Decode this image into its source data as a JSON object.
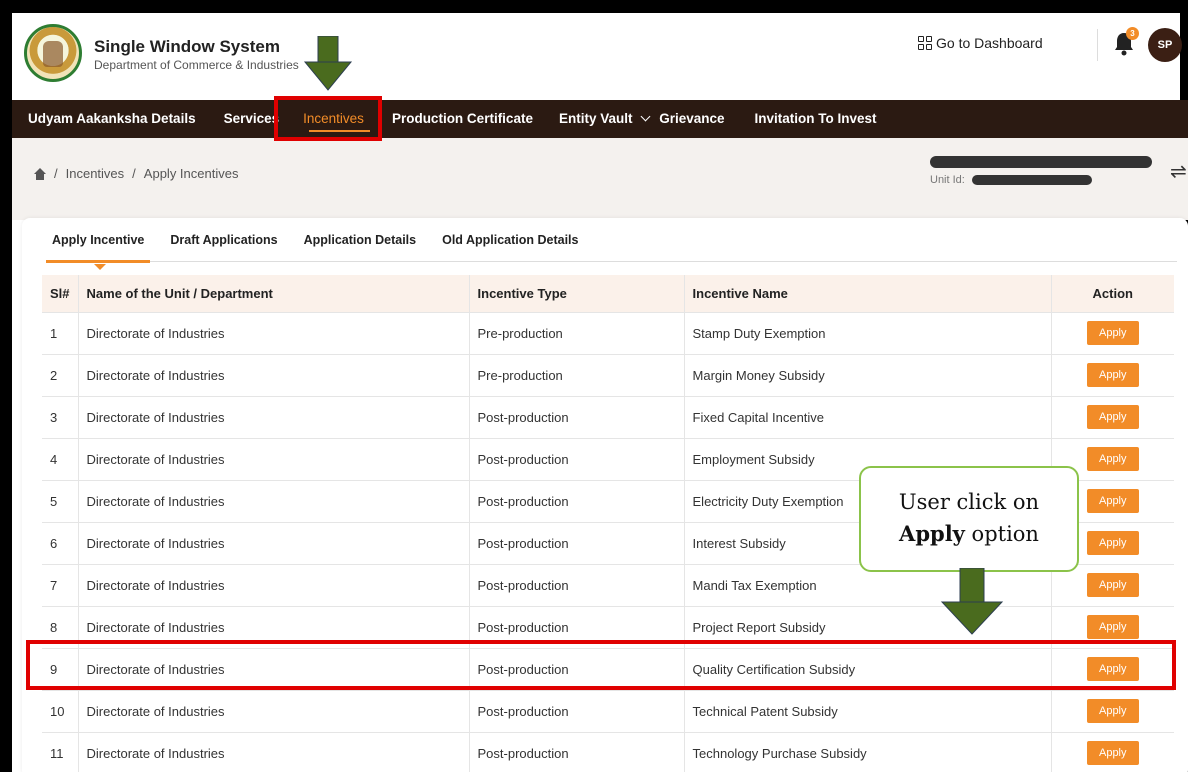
{
  "header": {
    "brand_title": "Single Window System",
    "brand_subtitle": "Department of Commerce & Industries",
    "dashboard_link": "Go to Dashboard",
    "notification_count": "3",
    "avatar_initials": "SP"
  },
  "nav": {
    "items": [
      {
        "label": "Udyam Aakanksha Details"
      },
      {
        "label": "Services"
      },
      {
        "label": "Incentives"
      },
      {
        "label": "Production Certificate"
      },
      {
        "label": "Entity Vault"
      },
      {
        "label": "Grievance"
      },
      {
        "label": "Invitation To Invest"
      }
    ]
  },
  "breadcrumb": {
    "items": [
      "Incentives",
      "Apply Incentives"
    ],
    "separator": "/"
  },
  "unit": {
    "id_label": "Unit Id:"
  },
  "tabs": [
    {
      "label": "Apply Incentive"
    },
    {
      "label": "Draft Applications"
    },
    {
      "label": "Application Details"
    },
    {
      "label": "Old Application Details"
    }
  ],
  "table": {
    "headers": [
      "Sl#",
      "Name of the Unit / Department",
      "Incentive Type",
      "Incentive Name",
      "Action"
    ],
    "action_label": "Apply",
    "rows": [
      {
        "sl": "1",
        "unit": "Directorate of Industries",
        "type": "Pre-production",
        "name": "Stamp Duty Exemption"
      },
      {
        "sl": "2",
        "unit": "Directorate of Industries",
        "type": "Pre-production",
        "name": "Margin Money Subsidy"
      },
      {
        "sl": "3",
        "unit": "Directorate of Industries",
        "type": "Post-production",
        "name": "Fixed Capital Incentive"
      },
      {
        "sl": "4",
        "unit": "Directorate of Industries",
        "type": "Post-production",
        "name": "Employment Subsidy"
      },
      {
        "sl": "5",
        "unit": "Directorate of Industries",
        "type": "Post-production",
        "name": "Electricity Duty Exemption"
      },
      {
        "sl": "6",
        "unit": "Directorate of Industries",
        "type": "Post-production",
        "name": "Interest Subsidy"
      },
      {
        "sl": "7",
        "unit": "Directorate of Industries",
        "type": "Post-production",
        "name": "Mandi Tax Exemption"
      },
      {
        "sl": "8",
        "unit": "Directorate of Industries",
        "type": "Post-production",
        "name": "Project Report Subsidy"
      },
      {
        "sl": "9",
        "unit": "Directorate of Industries",
        "type": "Post-production",
        "name": "Quality Certification Subsidy"
      },
      {
        "sl": "10",
        "unit": "Directorate of Industries",
        "type": "Post-production",
        "name": "Technical Patent Subsidy"
      },
      {
        "sl": "11",
        "unit": "Directorate of Industries",
        "type": "Post-production",
        "name": "Technology Purchase Subsidy"
      }
    ]
  },
  "annotation": {
    "callout_line1": "User click on",
    "callout_bold": "Apply",
    "callout_rest": " option"
  },
  "colors": {
    "accent": "#f28c28",
    "nav_bg": "#2b1a12",
    "highlight": "#e00000",
    "arrow": "#4a6b1e"
  }
}
